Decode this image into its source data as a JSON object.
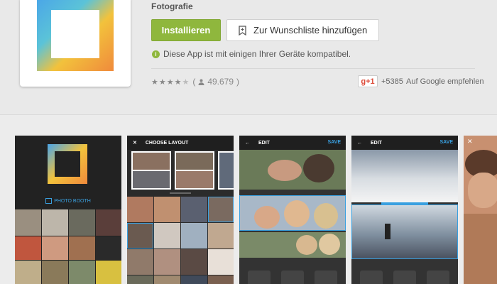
{
  "app": {
    "category": "Fotografie"
  },
  "actions": {
    "install_label": "Installieren",
    "wishlist_label": "Zur Wunschliste hinzufügen"
  },
  "compatibility": {
    "text": "Diese App ist mit einigen Ihrer Geräte kompatibel."
  },
  "rating": {
    "stars": 4.5,
    "count": "49.679",
    "open_paren": "(",
    "close_paren": ")"
  },
  "social": {
    "plus_label": "g+1",
    "plus_count": "+5385",
    "recommend_label": "Auf Google empfehlen"
  },
  "screenshots": {
    "s1_label": "PHOTO BOOTH",
    "s2_title": "CHOOSE LAYOUT",
    "s3_title": "EDIT",
    "s3_save": "SAVE",
    "s4_title": "EDIT",
    "s4_save": "SAVE"
  },
  "colors": {
    "install": "#8fb73d",
    "accent": "#3aa0e0",
    "gplus": "#dd4b39"
  }
}
